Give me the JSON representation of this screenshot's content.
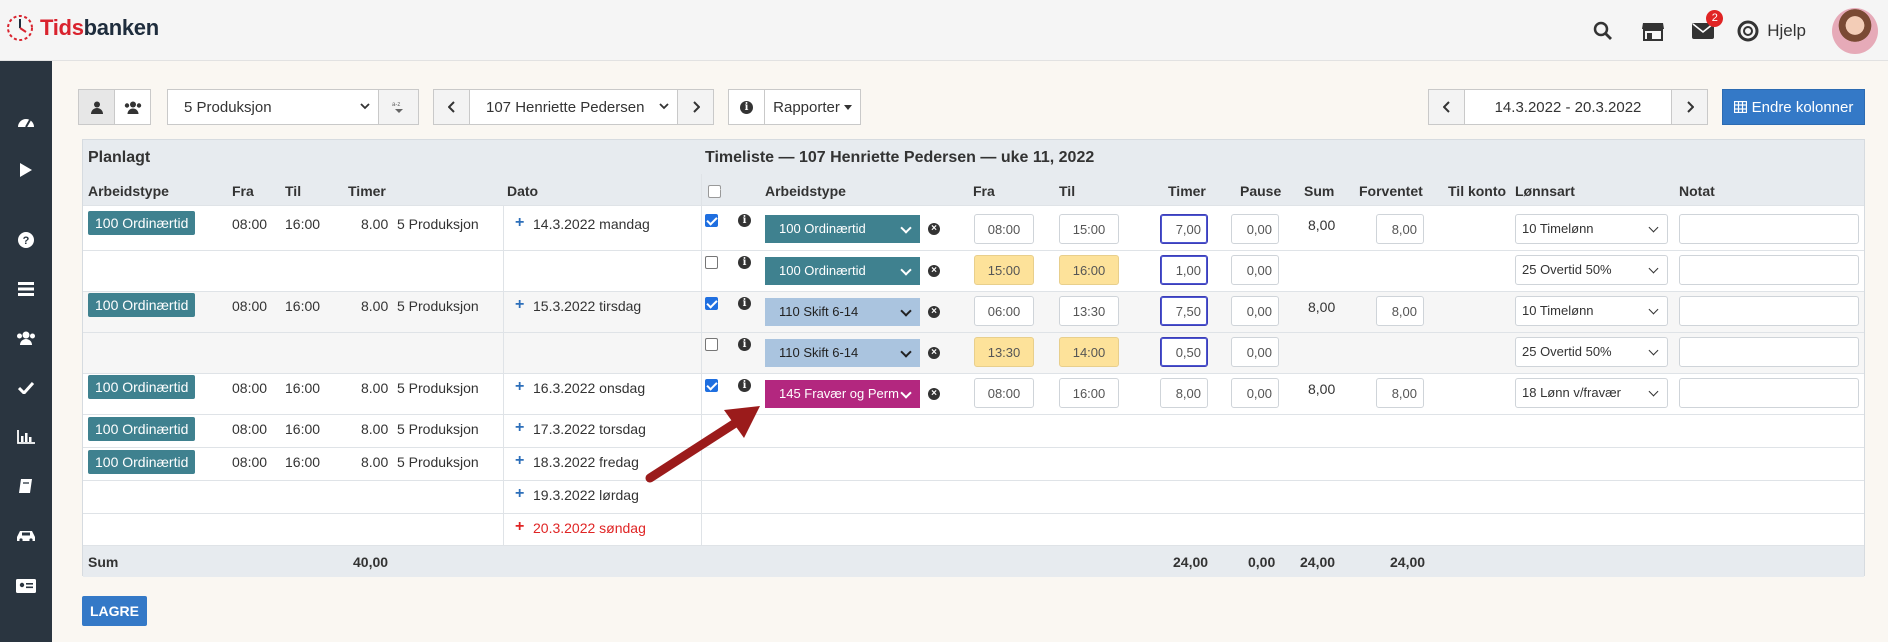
{
  "brand": {
    "part1": "Tids",
    "part2": "banken"
  },
  "topbar": {
    "help_label": "Hjelp",
    "mail_badge": "2"
  },
  "toolbar": {
    "department": "5 Produksjon",
    "employee": "107 Henriette Pedersen",
    "reports": "Rapporter",
    "period": "14.3.2022 - 20.3.2022",
    "change_columns": "Endre kolonner"
  },
  "section": {
    "planned_title": "Planlagt",
    "timesheet_title": "Timeliste — 107 Henriette Pedersen — uke 11, 2022"
  },
  "planned_headers": [
    "Arbeidstype",
    "Fra",
    "Til",
    "Timer",
    "Dato"
  ],
  "ts_headers": [
    "Arbeidstype",
    "Fra",
    "Til",
    "Timer",
    "Pause",
    "Sum",
    "Forventet",
    "Til konto",
    "Lønnsart",
    "Notat"
  ],
  "planned_rows": [
    {
      "type": "100 Ordinærtid",
      "from": "08:00",
      "to": "16:00",
      "hours": "8.00",
      "dept": "5 Produksjon",
      "date": "14.3.2022 mandag"
    },
    {
      "type": "",
      "from": "",
      "to": "",
      "hours": "",
      "dept": "",
      "date": ""
    },
    {
      "type": "100 Ordinærtid",
      "from": "08:00",
      "to": "16:00",
      "hours": "8.00",
      "dept": "5 Produksjon",
      "date": "15.3.2022 tirsdag"
    },
    {
      "type": "",
      "from": "",
      "to": "",
      "hours": "",
      "dept": "",
      "date": ""
    },
    {
      "type": "100 Ordinærtid",
      "from": "08:00",
      "to": "16:00",
      "hours": "8.00",
      "dept": "5 Produksjon",
      "date": "16.3.2022 onsdag"
    },
    {
      "type": "100 Ordinærtid",
      "from": "08:00",
      "to": "16:00",
      "hours": "8.00",
      "dept": "5 Produksjon",
      "date": "17.3.2022 torsdag"
    },
    {
      "type": "100 Ordinærtid",
      "from": "08:00",
      "to": "16:00",
      "hours": "8.00",
      "dept": "5 Produksjon",
      "date": "18.3.2022 fredag"
    },
    {
      "type": "",
      "from": "",
      "to": "",
      "hours": "",
      "dept": "",
      "date": "19.3.2022 lørdag"
    },
    {
      "type": "",
      "from": "",
      "to": "",
      "hours": "",
      "dept": "",
      "date": "20.3.2022 søndag"
    }
  ],
  "ts_rows": [
    {
      "checked": true,
      "type": "100 Ordinærtid",
      "type_style": "ordinary",
      "from": "08:00",
      "to": "15:00",
      "hours": "7,00",
      "pause": "0,00",
      "sum": "8,00",
      "expected": "8,00",
      "wage": "10 Timelønn",
      "highlight_times": false
    },
    {
      "checked": false,
      "type": "100 Ordinærtid",
      "type_style": "ordinary",
      "from": "15:00",
      "to": "16:00",
      "hours": "1,00",
      "pause": "0,00",
      "sum": "",
      "expected": "",
      "wage": "25 Overtid 50%",
      "highlight_times": true
    },
    {
      "checked": true,
      "type": "110 Skift 6-14",
      "type_style": "shift",
      "from": "06:00",
      "to": "13:30",
      "hours": "7,50",
      "pause": "0,00",
      "sum": "8,00",
      "expected": "8,00",
      "wage": "10 Timelønn",
      "highlight_times": false
    },
    {
      "checked": false,
      "type": "110 Skift 6-14",
      "type_style": "shift",
      "from": "13:30",
      "to": "14:00",
      "hours": "0,50",
      "pause": "0,00",
      "sum": "",
      "expected": "",
      "wage": "25 Overtid 50%",
      "highlight_times": true
    },
    {
      "checked": true,
      "type": "145 Fravær og Perm",
      "type_style": "absence",
      "from": "08:00",
      "to": "16:00",
      "hours": "8,00",
      "pause": "0,00",
      "sum": "8,00",
      "expected": "8,00",
      "wage": "18 Lønn v/fravær",
      "highlight_times": false
    }
  ],
  "totals": {
    "label": "Sum",
    "planned_hours": "40,00",
    "hours": "24,00",
    "pause": "0,00",
    "sum": "24,00",
    "expected": "24,00"
  },
  "save_button": "LAGRE",
  "colors": {
    "accent": "#3479c7",
    "ordinary": "#3f818f",
    "shift": "#aac4df",
    "absence": "#b3277f",
    "sunday": "#e02424",
    "arrow": "#9b1b1b"
  }
}
